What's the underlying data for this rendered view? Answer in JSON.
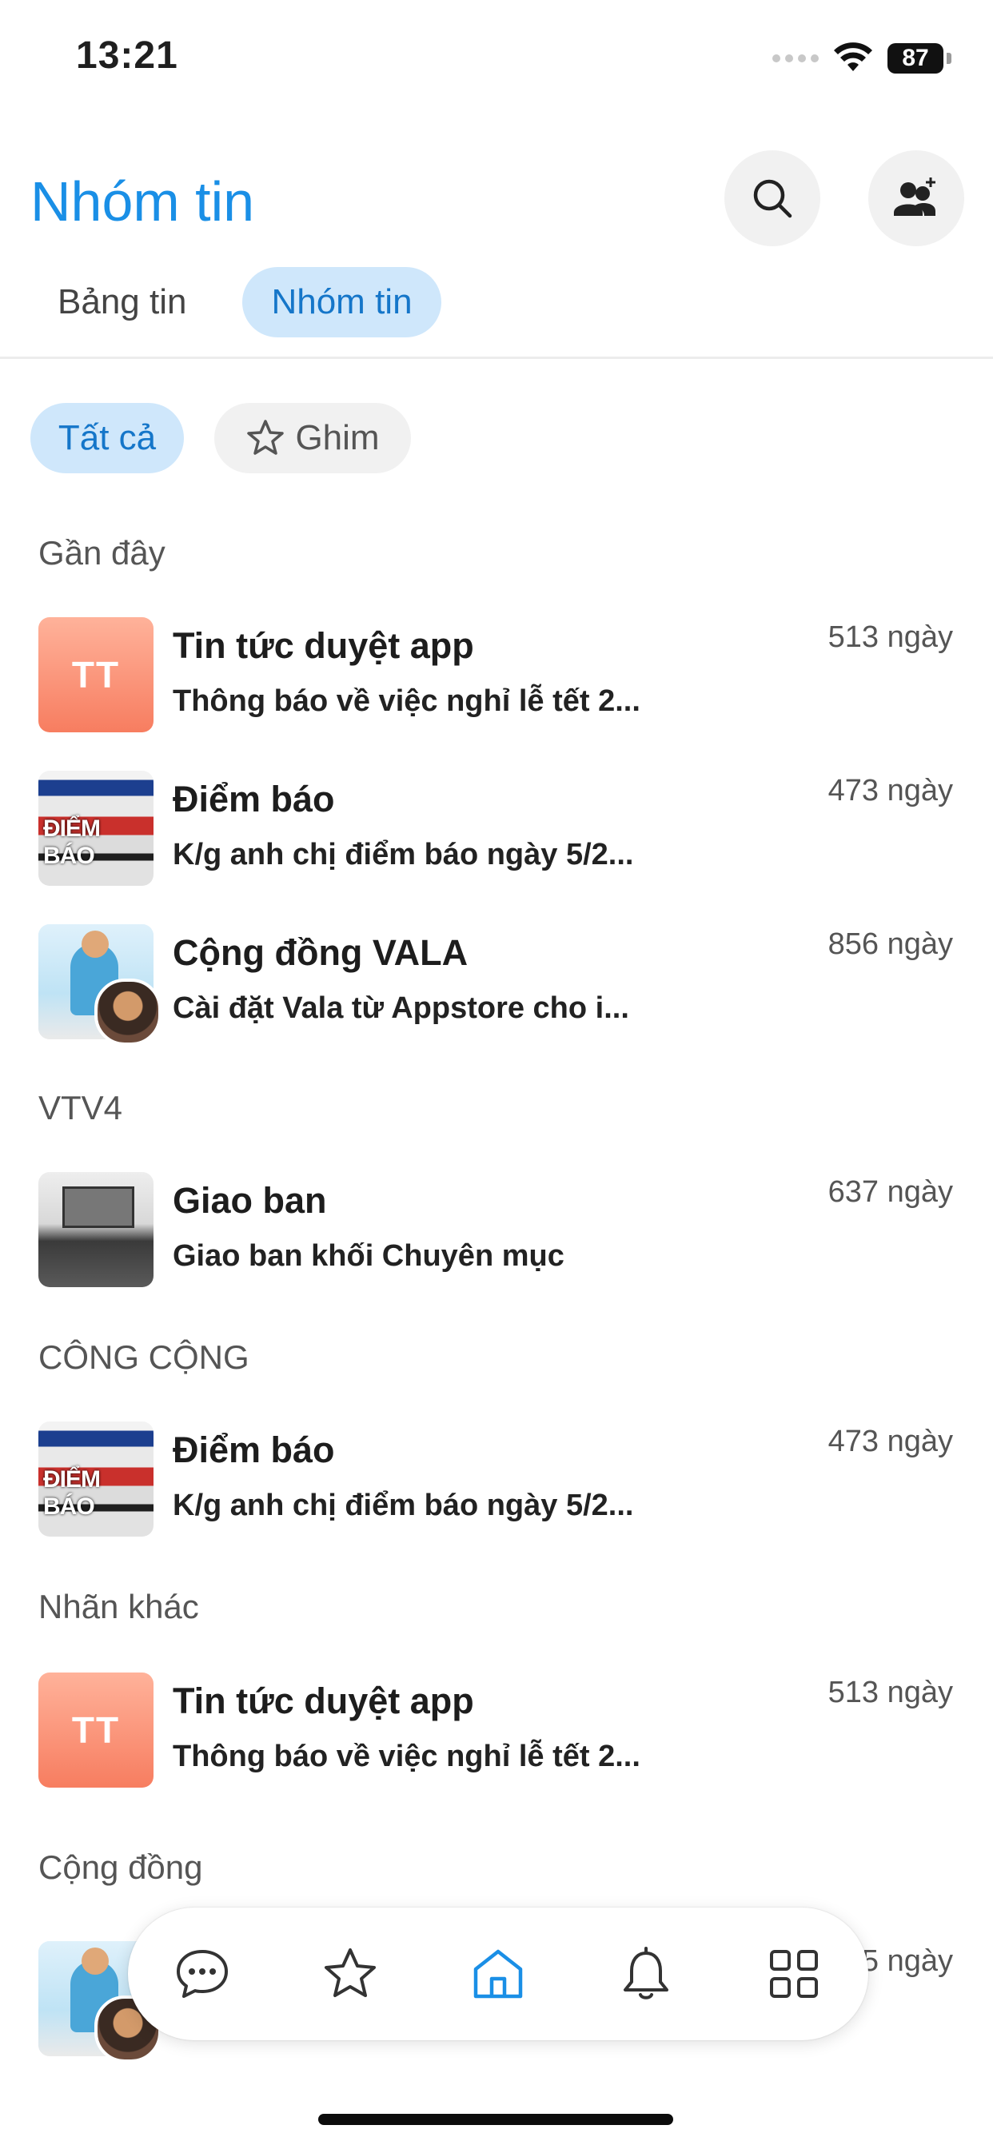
{
  "status_bar": {
    "time": "13:21",
    "battery": "87"
  },
  "header": {
    "title": "Nhóm tin",
    "search_icon": "search-icon",
    "add_group_icon": "add-user-icon"
  },
  "top_tabs": [
    {
      "label": "Bảng tin",
      "active": false
    },
    {
      "label": "Nhóm tin",
      "active": true
    }
  ],
  "filters": [
    {
      "label": "Tất cả",
      "active": true
    },
    {
      "label": "Ghim",
      "icon": "star-icon",
      "active": false
    }
  ],
  "sections": [
    {
      "title": "Gần đây",
      "items": [
        {
          "avatar": "TT",
          "avatar_style": "initials",
          "title": "Tin tức duyệt app",
          "preview": "Thông báo về việc nghỉ lễ tết 2...",
          "time": "513 ngày"
        },
        {
          "avatar": "newspaper",
          "avatar_style": "image",
          "title": "Điểm báo",
          "preview": "K/g anh chị điểm báo ngày 5/2...",
          "time": "473 ngày"
        },
        {
          "avatar": "community",
          "avatar_style": "image",
          "title": "Cộng đồng VALA",
          "preview": "Cài đặt Vala từ  Appstore cho i...",
          "time": "856 ngày"
        }
      ]
    },
    {
      "title": "VTV4",
      "items": [
        {
          "avatar": "meeting",
          "avatar_style": "image",
          "title": "Giao ban",
          "preview": "Giao ban khối Chuyên mục",
          "time": "637 ngày"
        }
      ]
    },
    {
      "title": "CÔNG CỘNG",
      "items": [
        {
          "avatar": "newspaper",
          "avatar_style": "image",
          "title": "Điểm báo",
          "preview": "K/g anh chị điểm báo ngày 5/2...",
          "time": "473 ngày"
        }
      ]
    },
    {
      "title": "Nhãn khác",
      "items": [
        {
          "avatar": "TT",
          "avatar_style": "initials",
          "title": "Tin tức duyệt app",
          "preview": "Thông báo về việc nghỉ lễ tết 2...",
          "time": "513 ngày"
        }
      ]
    },
    {
      "title": "Cộng đồng",
      "items": [
        {
          "avatar": "community",
          "avatar_style": "image",
          "title": "",
          "preview": "",
          "time": "5 ngày"
        }
      ]
    }
  ],
  "bottom_nav": [
    {
      "name": "chat-icon",
      "active": false
    },
    {
      "name": "star-icon",
      "active": false
    },
    {
      "name": "home-icon",
      "active": true
    },
    {
      "name": "bell-icon",
      "active": false
    },
    {
      "name": "grid-icon",
      "active": false
    }
  ],
  "newspaper_text": "ĐIỂM BÁO",
  "colors": {
    "accent": "#1a8fe6",
    "chip_active_bg": "#cfe7fb",
    "tt_avatar_top": "#ffb29a",
    "tt_avatar_bottom": "#f77d60"
  }
}
